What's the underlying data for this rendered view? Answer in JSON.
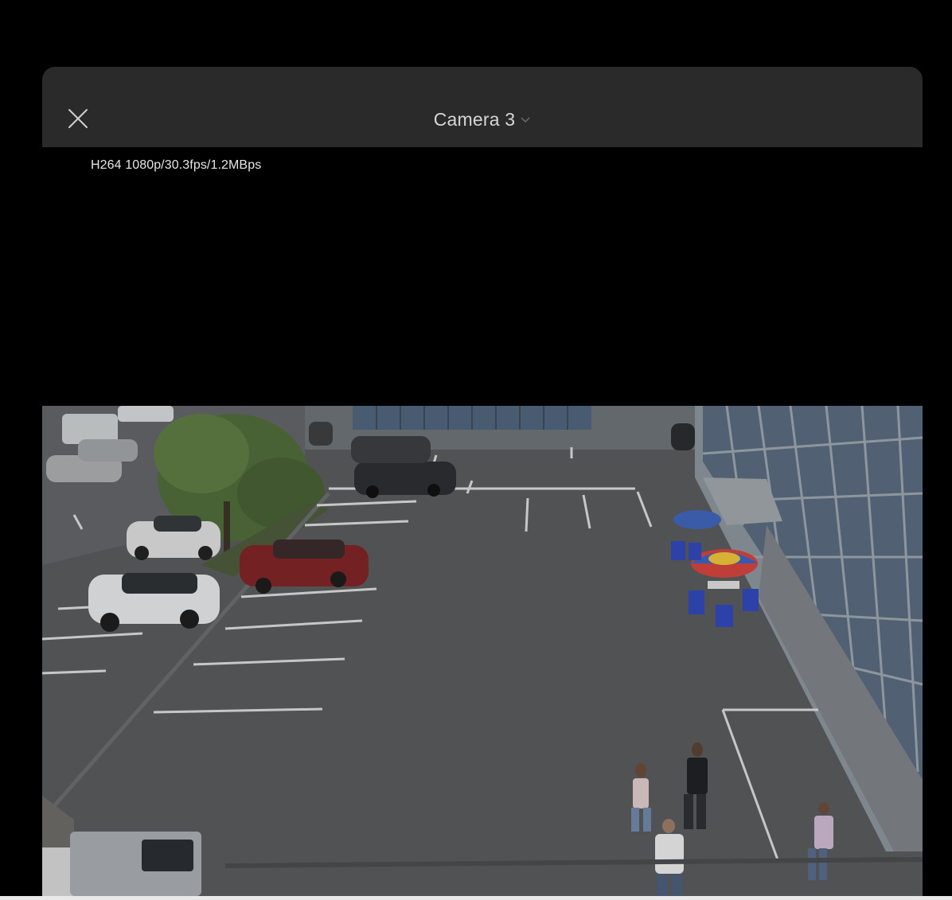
{
  "header": {
    "close_icon": "close-icon",
    "camera_title": "Camera 3",
    "dropdown_icon": "chevron-down-icon"
  },
  "stream_info": "H264 1080p/30.3fps/1.2MBps",
  "video": {
    "description_icon": "camera-feed"
  },
  "colors": {
    "background": "#000000",
    "header": "#2a2a2b",
    "title_text": "#d6d6d6"
  }
}
